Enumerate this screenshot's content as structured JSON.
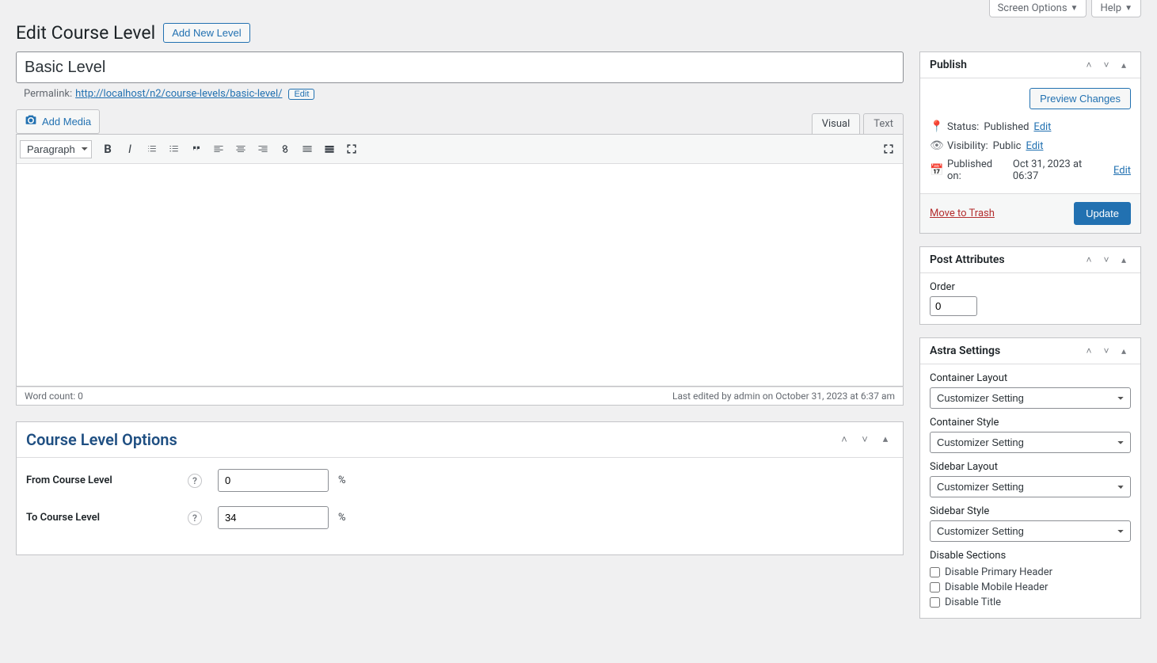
{
  "topTabs": {
    "screenOptions": "Screen Options",
    "help": "Help"
  },
  "header": {
    "title": "Edit Course Level",
    "addNew": "Add New Level"
  },
  "post": {
    "title_value": "Basic Level",
    "permalink_label": "Permalink:",
    "permalink_url": "http://localhost/n2/course-levels/basic-level/",
    "permalink_edit": "Edit"
  },
  "media": {
    "addMedia": "Add Media",
    "visualTab": "Visual",
    "textTab": "Text"
  },
  "toolbar": {
    "format": "Paragraph"
  },
  "statusbar": {
    "wordcount": "Word count: 0",
    "lastEdited": "Last edited by admin on October 31, 2023 at 6:37 am"
  },
  "courseLevelOptions": {
    "panelTitle": "Course Level Options",
    "fromLabel": "From Course Level",
    "fromValue": "0",
    "toLabel": "To Course Level",
    "toValue": "34",
    "unit": "%"
  },
  "publish": {
    "panelTitle": "Publish",
    "previewChanges": "Preview Changes",
    "statusLabel": "Status:",
    "statusValue": "Published",
    "visibilityLabel": "Visibility:",
    "visibilityValue": "Public",
    "publishedLabel": "Published on:",
    "publishedValue": "Oct 31, 2023 at 06:37",
    "editLink": "Edit",
    "trash": "Move to Trash",
    "update": "Update"
  },
  "postAttributes": {
    "panelTitle": "Post Attributes",
    "orderLabel": "Order",
    "orderValue": "0"
  },
  "astra": {
    "panelTitle": "Astra Settings",
    "containerLayoutLabel": "Container Layout",
    "containerStyleLabel": "Container Style",
    "sidebarLayoutLabel": "Sidebar Layout",
    "sidebarStyleLabel": "Sidebar Style",
    "selectValue": "Customizer Setting",
    "disableSectionsLabel": "Disable Sections",
    "disablePrimaryHeader": "Disable Primary Header",
    "disableMobileHeader": "Disable Mobile Header",
    "disableTitle": "Disable Title"
  }
}
